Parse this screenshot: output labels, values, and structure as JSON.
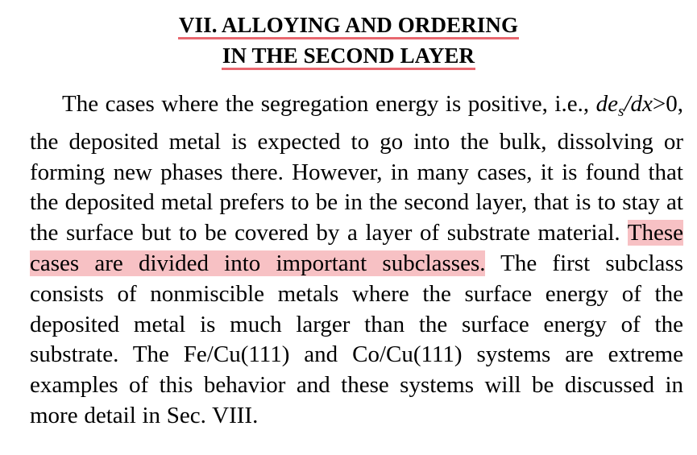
{
  "section": {
    "heading_line1": "VII. ALLOYING AND ORDERING",
    "heading_line2": "IN THE SECOND LAYER"
  },
  "paragraph": {
    "part1": "The cases where the segregation energy is positive, i.e., ",
    "math_d": "de",
    "math_sub": "s",
    "math_rest": "/dx",
    "math_gt": ">0",
    "part2": ", the deposited metal is expected to go into the bulk, dissolving or forming new phases there. However, in many cases, it is found that the deposited metal prefers to be in the second layer, that is to stay at the surface but to be covered by a layer of substrate material. ",
    "highlight": "These cases are divided into important subclasses.",
    "part3": " The first subclass consists of nonmiscible metals where the surface energy of the deposited metal is much larger than the surface energy of the substrate. The Fe/Cu(111) and Co/Cu(111) systems are extreme examples of this behavior and these systems will be discussed in more detail in Sec. VIII."
  },
  "colors": {
    "heading_underline": "#e8676f",
    "highlight": "#f7c1c4"
  }
}
